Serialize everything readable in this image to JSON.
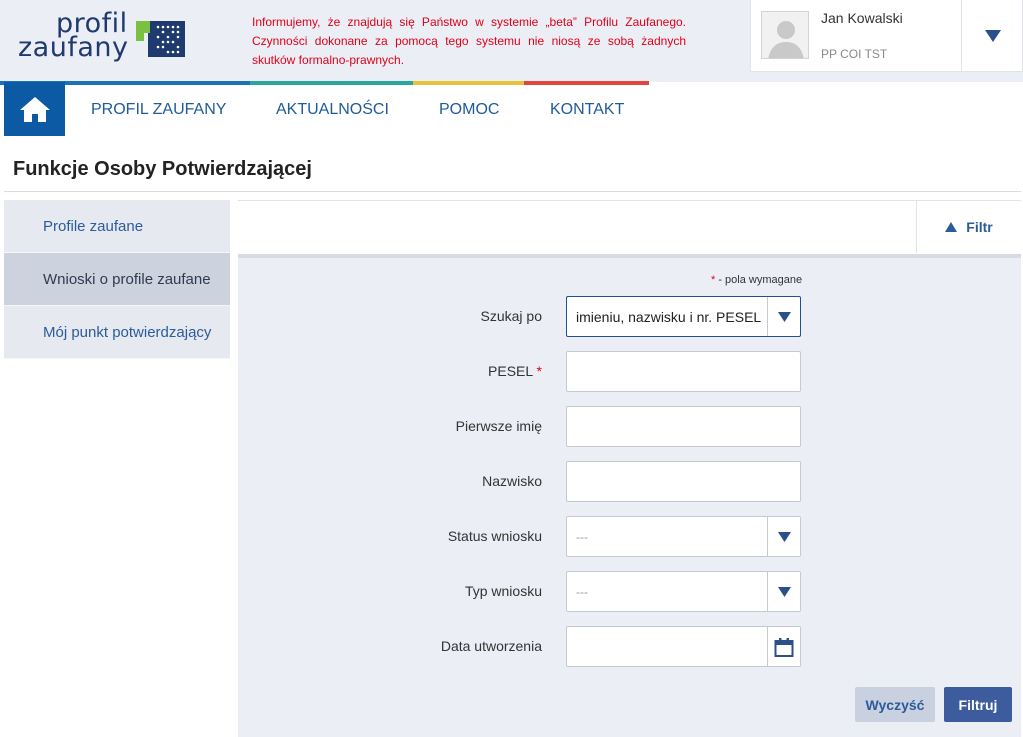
{
  "header": {
    "logo_line1": "profil",
    "logo_line2": "zaufany",
    "notice": "Informujemy, że znajdują się Państwo w systemie „beta” Profilu Zaufanego. Czynności dokonane za pomocą tego systemu nie niosą ze sobą żadnych skutków formalno-prawnych."
  },
  "user": {
    "name": "Jan Kowalski",
    "unit": "PP COI TST",
    "avatar_icon": "user-silhouette-icon",
    "toggle_icon": "chevron-down-icon"
  },
  "nav": {
    "home_icon": "home-icon",
    "items": [
      {
        "label": "PROFIL ZAUFANY"
      },
      {
        "label": "AKTUALNOŚCI"
      },
      {
        "label": "POMOC"
      },
      {
        "label": "KONTAKT"
      }
    ]
  },
  "colorbar": [
    "#1a73b8",
    "#2aa5a0",
    "#e8c33a",
    "#e0463d"
  ],
  "page": {
    "title": "Funkcje Osoby Potwierdzającej"
  },
  "sidebar": {
    "items": [
      {
        "label": "Profile zaufane",
        "active": false
      },
      {
        "label": "Wnioski o profile zaufane",
        "active": true
      },
      {
        "label": "Mój punkt potwierdzający",
        "active": false
      }
    ]
  },
  "filter": {
    "toggle_label": "Filtr",
    "toggle_icon": "triangle-up-icon",
    "required_mark": "*",
    "required_note": " - pola wymagane",
    "fields": {
      "search_by": {
        "label": "Szukaj po",
        "value": "imieniu, nazwisku i nr. PESEL"
      },
      "pesel": {
        "label": "PESEL",
        "value": "",
        "required_mark": "*"
      },
      "first_name": {
        "label": "Pierwsze imię",
        "value": ""
      },
      "last_name": {
        "label": "Nazwisko",
        "value": ""
      },
      "status": {
        "label": "Status wniosku",
        "value": "---"
      },
      "type": {
        "label": "Typ wniosku",
        "value": "---"
      },
      "created": {
        "label": "Data utworzenia",
        "value": "",
        "icon": "calendar-icon"
      }
    },
    "clear_label": "Wyczyść",
    "submit_label": "Filtruj"
  },
  "colors": {
    "primary": "#3d5c9e",
    "link": "#2b5c9a",
    "alert": "#e1001a",
    "home": "#0c5aa3"
  }
}
